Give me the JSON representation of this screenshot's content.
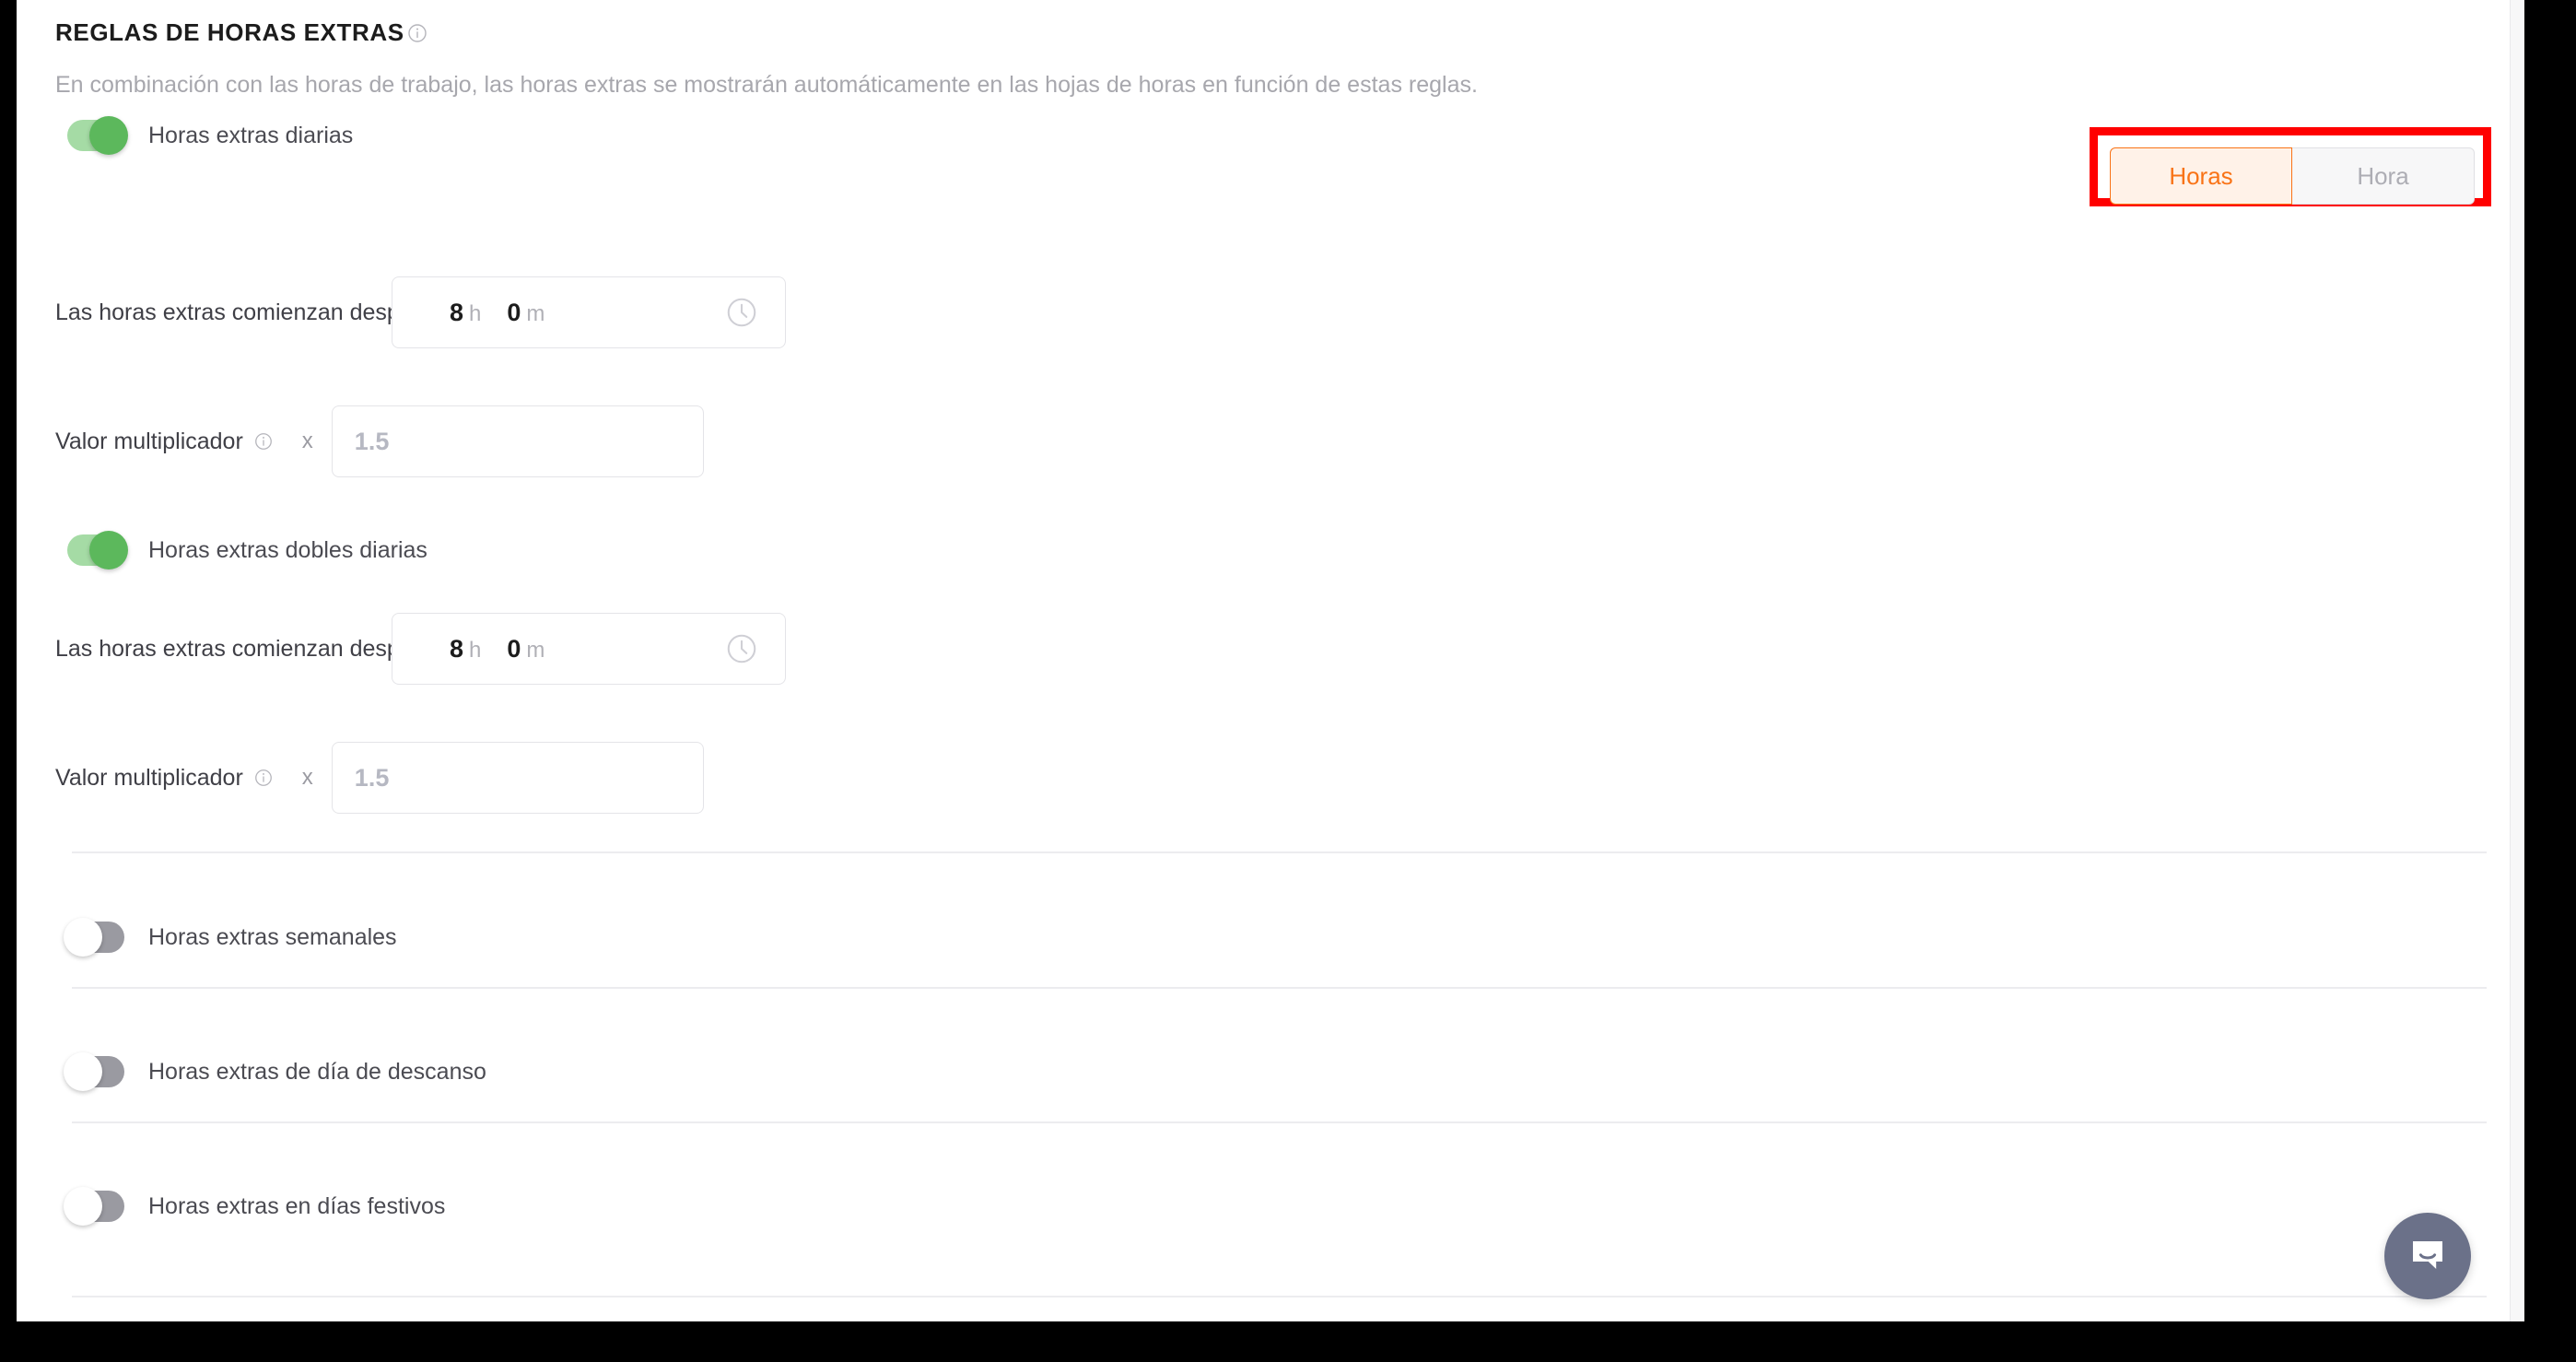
{
  "section": {
    "title": "REGLAS DE HORAS EXTRAS",
    "title_info_icon": "info-icon",
    "description": "En combinación con las horas de trabajo, las horas extras se mostrarán automáticamente en las hojas de horas en función de estas reglas."
  },
  "unit_toggle": {
    "options": [
      {
        "label": "Horas",
        "selected": true
      },
      {
        "label": "Hora",
        "selected": false
      }
    ],
    "selected_value": "Horas",
    "accent_color": "#f97316",
    "active_background": "#fff2e8",
    "inactive_background": "#f7f7f8",
    "inactive_text_color": "#adadb4",
    "highlight_box_color": "#ff0000"
  },
  "rules": [
    {
      "toggle_label": "Horas extras diarias",
      "toggle_state": "on",
      "start_after": {
        "label": "Las horas extras comienzan después de",
        "hours_value": "8",
        "hours_unit": "h",
        "minutes_value": "0",
        "minutes_unit": "m",
        "icon": "clock-icon"
      },
      "multiplier": {
        "label": "Valor multiplicador",
        "info_icon": "info-icon",
        "symbol": "x",
        "placeholder": "1.5",
        "value": ""
      }
    },
    {
      "toggle_label": "Horas extras dobles diarias",
      "toggle_state": "on",
      "start_after": {
        "label": "Las horas extras comienzan después de",
        "hours_value": "8",
        "hours_unit": "h",
        "minutes_value": "0",
        "minutes_unit": "m",
        "icon": "clock-icon"
      },
      "multiplier": {
        "label": "Valor multiplicador",
        "info_icon": "info-icon",
        "symbol": "x",
        "placeholder": "1.5",
        "value": ""
      }
    }
  ],
  "simple_rules": [
    {
      "label": "Horas extras semanales",
      "state": "off"
    },
    {
      "label": "Horas extras de día de descanso",
      "state": "off"
    },
    {
      "label": "Horas extras en días festivos",
      "state": "off"
    }
  ],
  "chat": {
    "icon": "chat-bubble-icon",
    "background_color": "#6b7189"
  },
  "colors": {
    "toggle_on_track": "#a5dba5",
    "toggle_on_knob": "#5cb85c",
    "toggle_off_track": "#9a9aa1",
    "toggle_off_knob": "#ffffff",
    "divider": "#ececef",
    "page_background": "#ffffff"
  }
}
